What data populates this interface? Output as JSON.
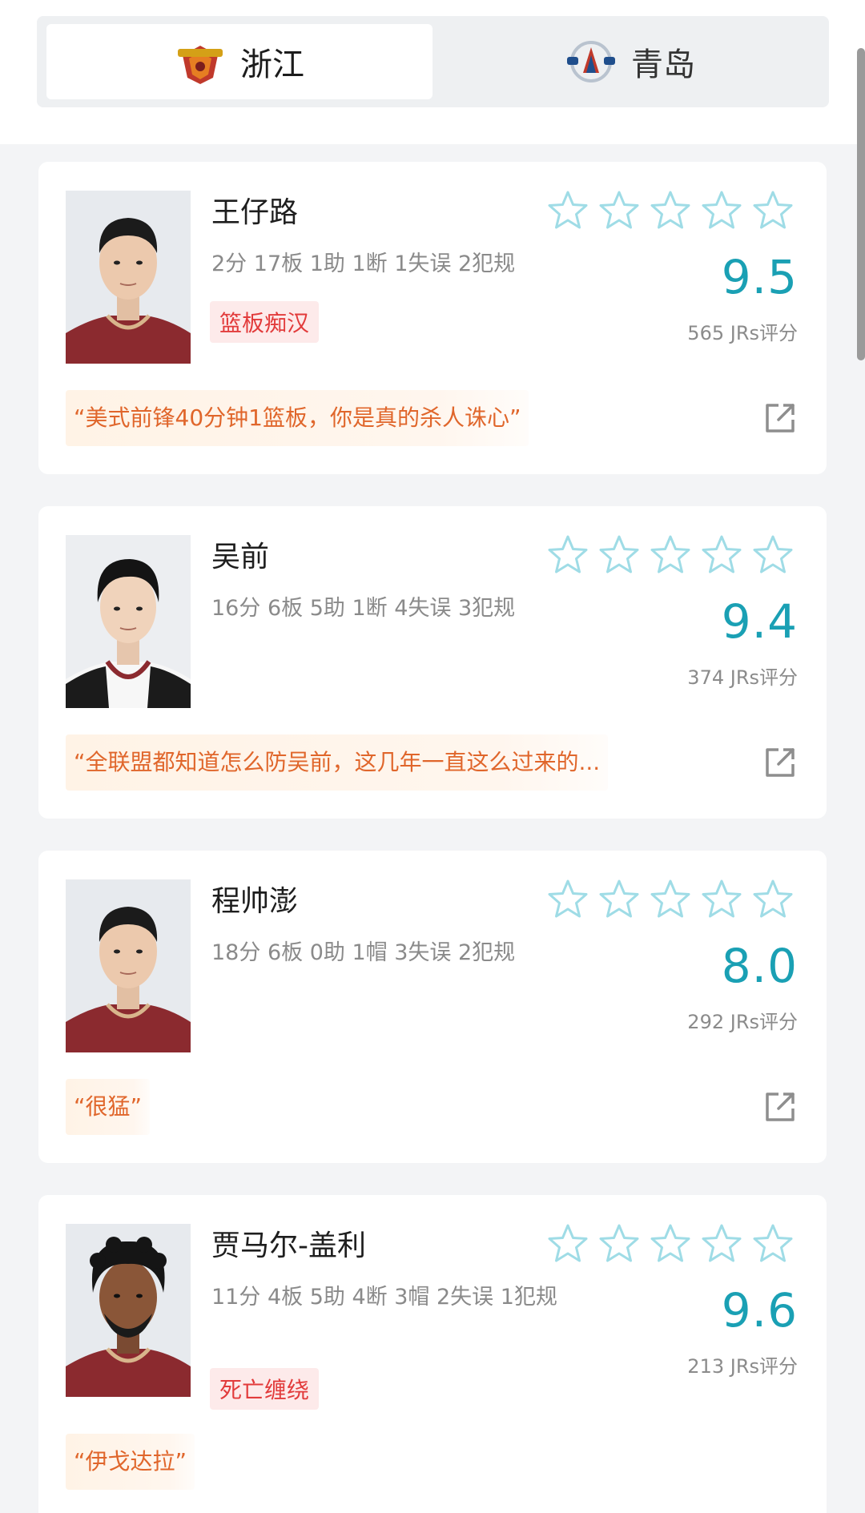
{
  "tabs": [
    {
      "label": "浙江",
      "logo": "golden-bulls-logo",
      "active": true
    },
    {
      "label": "青岛",
      "logo": "qingdao-eagles-logo",
      "active": false
    }
  ],
  "colors": {
    "accent": "#1aa0b4",
    "quote_text": "#e0662b",
    "tag_text": "#e23b3b",
    "star_outline": "#9fdce6"
  },
  "players": [
    {
      "name": "王仔路",
      "stats": "2分 17板 1助 1断 1失误 2犯规",
      "tag": "篮板痴汉",
      "score": "9.5",
      "votes": "565 JRs评分",
      "quote": "“美式前锋40分钟1篮板，你是真的杀人诛心”",
      "jersey": "maroon"
    },
    {
      "name": "吴前",
      "stats": "16分 6板 5助 1断 4失误 3犯规",
      "tag": "",
      "score": "9.4",
      "votes": "374 JRs评分",
      "quote": "“全联盟都知道怎么防吴前，这几年一直这么过来的...",
      "jersey": "white"
    },
    {
      "name": "程帅澎",
      "stats": "18分 6板 0助 1帽 3失误 2犯规",
      "tag": "",
      "score": "8.0",
      "votes": "292 JRs评分",
      "quote": "“很猛”",
      "jersey": "maroon"
    },
    {
      "name": "贾马尔-盖利",
      "stats": "11分 4板 5助 4断 3帽 2失误 1犯规",
      "tag": "死亡缠绕",
      "score": "9.6",
      "votes": "213 JRs评分",
      "quote": "“伊戈达拉”",
      "jersey": "maroon"
    }
  ]
}
